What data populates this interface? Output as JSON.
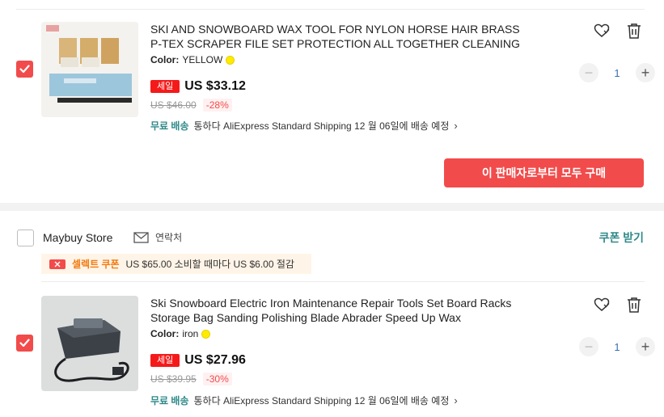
{
  "item1": {
    "title": "SKI AND SNOWBOARD WAX TOOL FOR NYLON HORSE HAIR BRASS P-TEX SCRAPER FILE SET PROTECTION ALL TOGETHER CLEANING",
    "color_label": "Color:",
    "color_value": "YELLOW",
    "sale_badge": "세일",
    "price": "US $33.12",
    "old_price": "US $46.00",
    "discount": "-28%",
    "free_shipping": "무료 배송",
    "shipping_text": "통하다 AliExpress Standard Shipping 12 월 06일에 배송 예정",
    "quantity": "1"
  },
  "buy_all_label": "이 판매자로부터 모두 구매",
  "store": {
    "name": "Maybuy Store",
    "contact_label": "연락처",
    "coupon_label": "쿠폰 받기",
    "promo_tag": "셀렉트 쿠폰",
    "promo_text": "US $65.00 소비할 때마다 US $6.00 절감"
  },
  "item2": {
    "title": "Ski Snowboard Electric Iron Maintenance Repair Tools Set Board Racks Storage Bag Sanding Polishing Blade Abrader Speed Up Wax",
    "color_label": "Color:",
    "color_value": "iron",
    "sale_badge": "세일",
    "price": "US $27.96",
    "old_price": "US $39.95",
    "discount": "-30%",
    "free_shipping": "무료 배송",
    "shipping_text": "통하다 AliExpress Standard Shipping 12 월 06일에 배송 예정",
    "quantity": "1"
  },
  "colors": {
    "accent_red": "#f24b4b",
    "teal": "#2f8a89",
    "swatch_yellow": "#ffeb00"
  }
}
